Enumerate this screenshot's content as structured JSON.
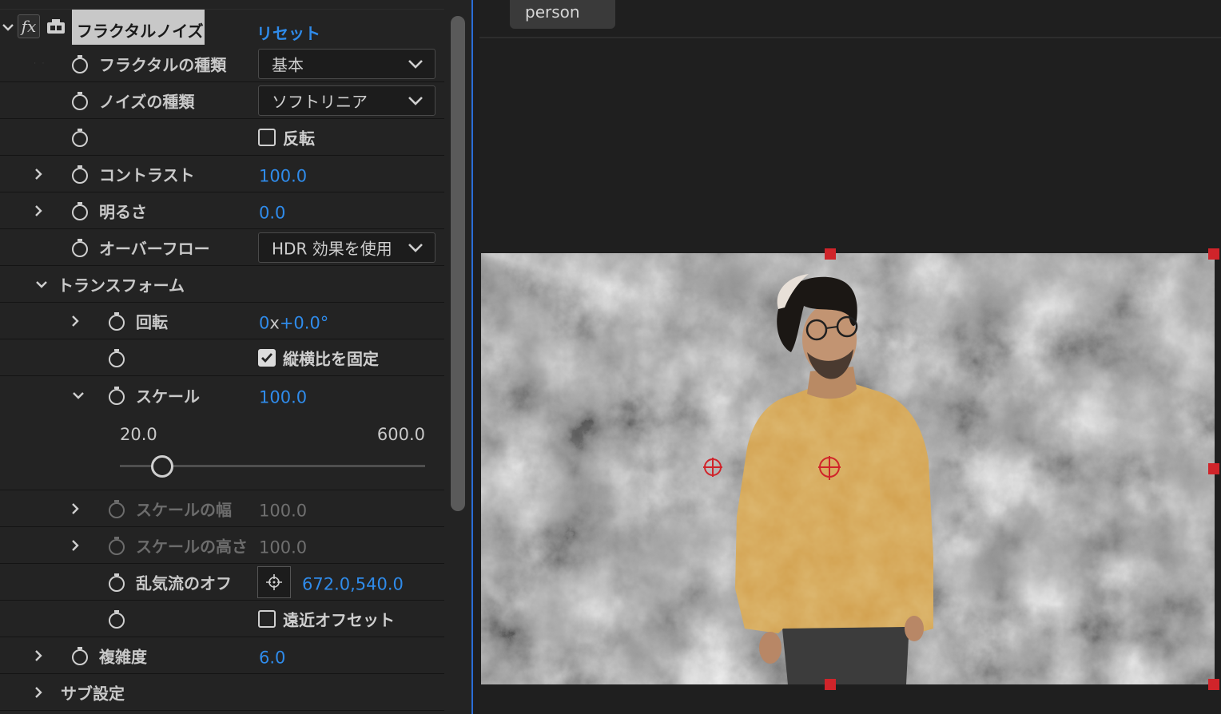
{
  "effect": {
    "name": "フラクタルノイズ",
    "reset_label": "リセット",
    "fx_label": "fx"
  },
  "properties": {
    "fractal_type": {
      "label": "フラクタルの種類",
      "value": "基本"
    },
    "noise_type": {
      "label": "ノイズの種類",
      "value": "ソフトリニア"
    },
    "invert": {
      "label": "反転",
      "checked": false
    },
    "contrast": {
      "label": "コントラスト",
      "value": "100.0"
    },
    "brightness": {
      "label": "明るさ",
      "value": "0.0"
    },
    "overflow": {
      "label": "オーバーフロー",
      "value": "HDR 効果を使用"
    },
    "transform": {
      "label": "トランスフォーム"
    },
    "rotation": {
      "label": "回転",
      "value_prefix": "0",
      "value_x": "x",
      "value_rest": "+0.0°"
    },
    "uniform_scaling": {
      "label": "縦横比を固定",
      "checked": true
    },
    "scale": {
      "label": "スケール",
      "value": "100.0",
      "min": "20.0",
      "max": "600.0",
      "level": 0.138
    },
    "scale_width": {
      "label": "スケールの幅",
      "value": "100.0"
    },
    "scale_height": {
      "label": "スケールの高さ",
      "value": "100.0"
    },
    "offset_turbulence": {
      "label": "乱気流のオフ",
      "value": "672.0,540.0"
    },
    "perspective_offset": {
      "label": "遠近オフセット",
      "checked": false
    },
    "complexity": {
      "label": "複雑度",
      "value": "6.0"
    },
    "sub_settings": {
      "label": "サブ設定"
    }
  },
  "viewer": {
    "tab_label": "person"
  },
  "colors": {
    "accent_blue": "#2f8bea",
    "handle_red": "#d0242a",
    "panel_bg": "#232323"
  }
}
